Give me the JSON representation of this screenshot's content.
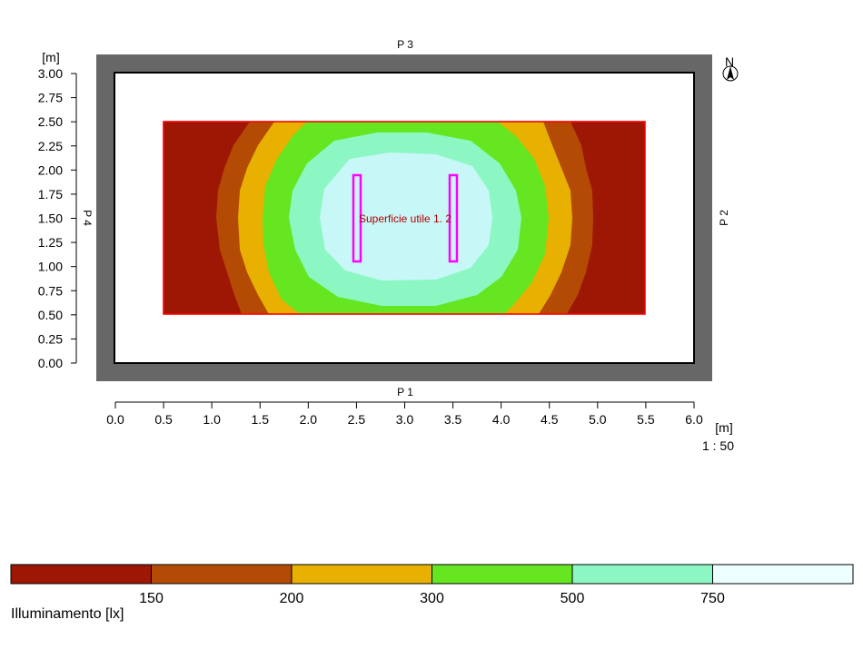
{
  "plan": {
    "unit_y": "[m]",
    "unit_x": "[m]",
    "scale": "1 : 50",
    "north": "N",
    "walls": {
      "top": "P 3",
      "bottom": "P 1",
      "left": "P 4",
      "right": "P 2"
    },
    "y_ticks": [
      "0.00",
      "0.25",
      "0.50",
      "0.75",
      "1.00",
      "1.25",
      "1.50",
      "1.75",
      "2.00",
      "2.25",
      "2.50",
      "2.75",
      "3.00"
    ],
    "x_ticks": [
      "0.0",
      "0.5",
      "1.0",
      "1.5",
      "2.0",
      "2.5",
      "3.0",
      "3.5",
      "4.0",
      "4.5",
      "5.0",
      "5.5",
      "6.0"
    ],
    "work_surface_label": "Superficie utile 1. 2",
    "luminaires": [
      {
        "x": 2.5,
        "y": 1.5
      },
      {
        "x": 3.5,
        "y": 1.5
      }
    ]
  },
  "legend": {
    "title": "Illuminamento [lx]",
    "thresholds": [
      "150",
      "200",
      "300",
      "500",
      "750"
    ],
    "colors": [
      "#9e1604",
      "#b44b05",
      "#e8b000",
      "#66e621",
      "#8df7c4",
      "#eeffff"
    ]
  }
}
